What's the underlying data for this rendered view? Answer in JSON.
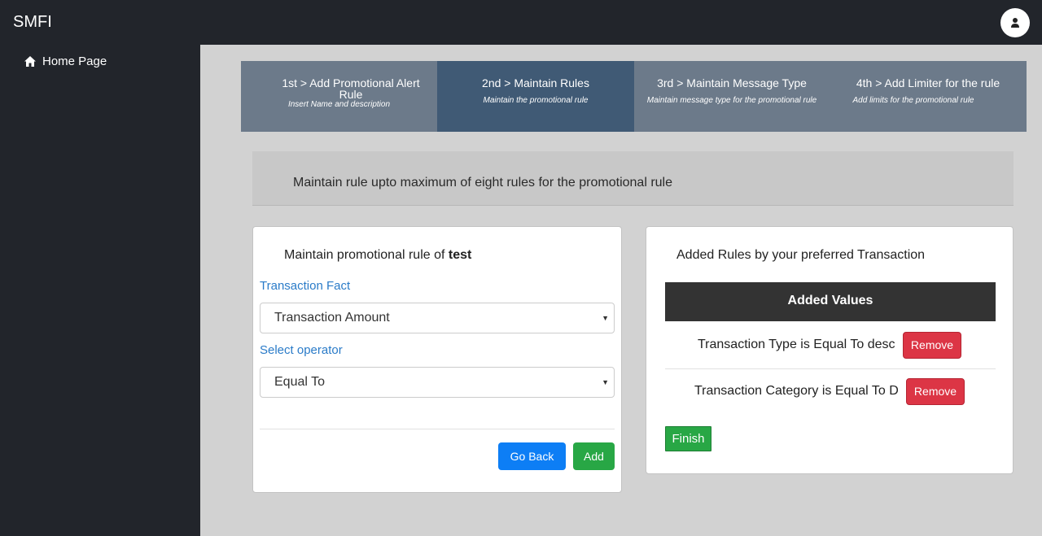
{
  "app": {
    "title": "SMFI"
  },
  "sidebar": {
    "items": [
      {
        "label": "Home Page",
        "icon": "home-icon"
      }
    ]
  },
  "steps": [
    {
      "title": "1st > Add Promotional Alert Rule",
      "subtitle": "Insert Name and description",
      "active": false
    },
    {
      "title": "2nd > Maintain Rules",
      "subtitle": "Maintain the promotional rule",
      "active": true
    },
    {
      "title": "3rd > Maintain Message Type",
      "subtitle": "Maintain message type for the promotional rule",
      "active": false
    },
    {
      "title": "4th > Add Limiter for the rule",
      "subtitle": "Add limits for the promotional rule",
      "active": false
    }
  ],
  "info": {
    "text": "Maintain rule upto maximum of eight rules for the promotional rule"
  },
  "form": {
    "heading_prefix": "Maintain promotional rule of",
    "rule_name": "test",
    "fact_label": "Transaction Fact",
    "fact_value": "Transaction Amount",
    "operator_label": "Select operator",
    "operator_value": "Equal To",
    "back_label": "Go Back",
    "add_label": "Add"
  },
  "added": {
    "heading": "Added Rules by your preferred Transaction",
    "column": "Added Values",
    "rows": [
      {
        "text": "Transaction Type is Equal To desc",
        "action": "Remove"
      },
      {
        "text": "Transaction Category is Equal To D",
        "action": "Remove"
      }
    ],
    "finish_label": "Finish"
  },
  "colors": {
    "topbar": "#22252b",
    "steps_bg": "#6c7a8a",
    "step_active": "#405a75",
    "link_blue": "#2a7bc8",
    "primary": "#0d7ef5",
    "success": "#28a745",
    "danger": "#dc3545"
  }
}
